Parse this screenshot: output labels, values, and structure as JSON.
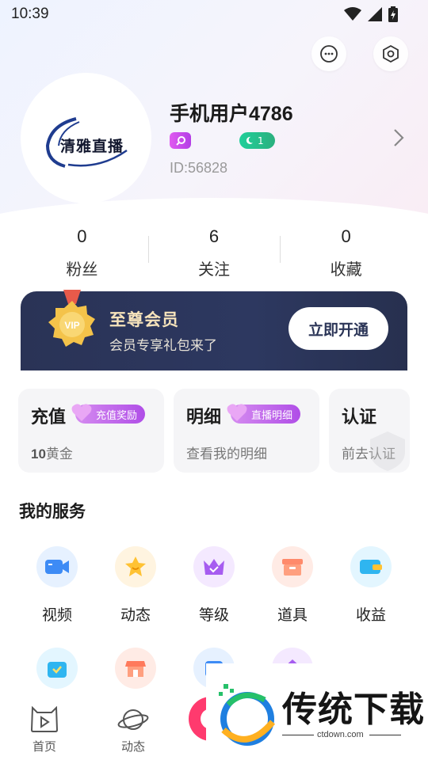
{
  "status_bar": {
    "time": "10:39"
  },
  "profile": {
    "avatar_text": "清雅直播",
    "username": "手机用户4786",
    "level_badge": "1",
    "user_id": "ID:56828"
  },
  "stats": [
    {
      "value": "0",
      "label": "粉丝"
    },
    {
      "value": "6",
      "label": "关注"
    },
    {
      "value": "0",
      "label": "收藏"
    }
  ],
  "vip": {
    "medal_text": "VIP",
    "title": "至尊会员",
    "subtitle": "会员专享礼包来了",
    "button": "立即开通"
  },
  "cards": [
    {
      "title": "充值",
      "tag": "充值奖励",
      "value": "10",
      "unit": "黄金"
    },
    {
      "title": "明细",
      "tag": "直播明细",
      "subtitle": "查看我的明细"
    },
    {
      "title": "认证",
      "subtitle": "前去认证"
    }
  ],
  "services": {
    "title": "我的服务",
    "items": [
      {
        "label": "视频",
        "icon": "video-icon",
        "color": "#3d8bf5",
        "bg": "#e6f1ff"
      },
      {
        "label": "动态",
        "icon": "star-face-icon",
        "color": "#ffc233",
        "bg": "#fff4e0"
      },
      {
        "label": "等级",
        "icon": "crown-icon",
        "color": "#a65cf0",
        "bg": "#f4e9ff"
      },
      {
        "label": "道具",
        "icon": "box-icon",
        "color": "#ff8a6b",
        "bg": "#ffebe5"
      },
      {
        "label": "收益",
        "icon": "wallet-icon",
        "color": "#2fb5f0",
        "bg": "#e3f6ff"
      }
    ]
  },
  "tabbar": [
    {
      "label": "首页",
      "icon": "home-tv-icon"
    },
    {
      "label": "动态",
      "icon": "planet-icon"
    }
  ],
  "watermark": {
    "title": "传统下载",
    "url": "ctdown.com"
  }
}
